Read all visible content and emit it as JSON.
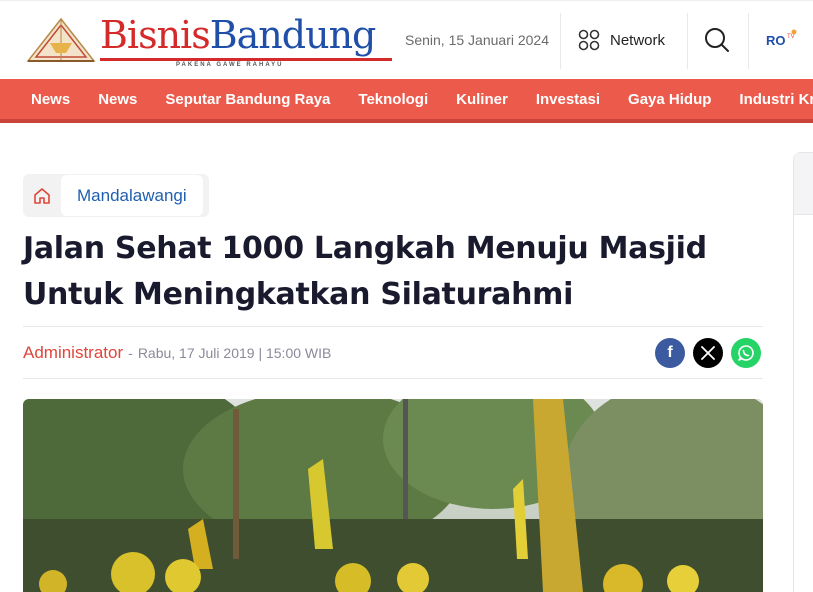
{
  "header": {
    "logo": {
      "word1": "Bisnis",
      "word2": "Bandung",
      "tagline": "PAKENA GAWE RAHAYU"
    },
    "date": "Senin, 15 Januari 2024",
    "network_label": "Network",
    "rotv_logo": "RO TV"
  },
  "nav": {
    "items": [
      "News",
      "News",
      "Seputar Bandung Raya",
      "Teknologi",
      "Kuliner",
      "Investasi",
      "Gaya Hidup",
      "Industri Kreatif"
    ]
  },
  "breadcrumb": {
    "category": "Mandalawangi"
  },
  "article": {
    "title": "Jalan Sehat 1000 Langkah Menuju Masjid Untuk Meningkatkan Silaturahmi",
    "author": "Administrator",
    "separator": "-",
    "published": "Rabu, 17 Juli 2019 | 15:00 WIB"
  },
  "share": {
    "facebook_glyph": "f"
  },
  "colors": {
    "brand_red": "#d42a2a",
    "brand_blue": "#1f4fa8",
    "nav_bg": "#ec5a4b",
    "author": "#e0453a",
    "category_link": "#1f5fb0",
    "facebook": "#3b5aa0",
    "x": "#000000",
    "whatsapp": "#25d366"
  },
  "icons": [
    "network-icon",
    "search-icon",
    "home-icon",
    "facebook-icon",
    "x-icon",
    "whatsapp-icon"
  ]
}
